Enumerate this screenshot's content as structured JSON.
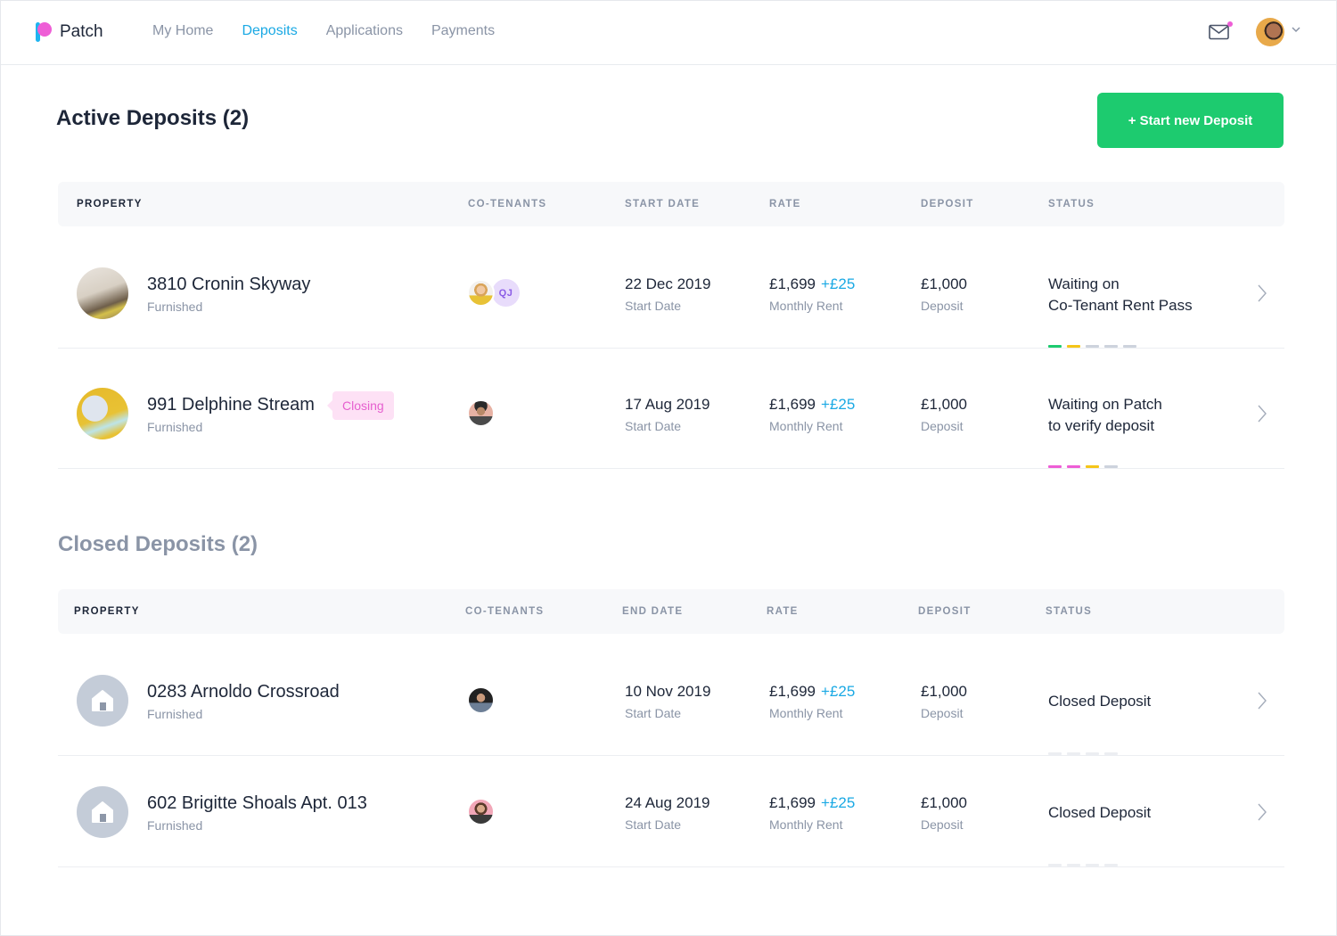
{
  "app": {
    "name": "Patch"
  },
  "nav": {
    "links": [
      {
        "label": "My Home",
        "active": false
      },
      {
        "label": "Deposits",
        "active": true
      },
      {
        "label": "Applications",
        "active": false
      },
      {
        "label": "Payments",
        "active": false
      }
    ],
    "mail_icon": "mail-icon",
    "has_notification": true
  },
  "colors": {
    "accent": "#1aa9e4",
    "brand_pink": "#ee5ed6",
    "primary_button": "#1dcb6f",
    "progress_green": "#1dcb6f",
    "progress_yellow": "#f5c518",
    "progress_pink": "#ee5ed6",
    "progress_grey": "#cdd3dd",
    "progress_faint": "#eceef2"
  },
  "active": {
    "heading": "Active Deposits (2)",
    "start_button": "+ Start new Deposit",
    "columns": [
      "PROPERTY",
      "CO-TENANTS",
      "START DATE",
      "RATE",
      "DEPOSIT",
      "STATUS"
    ],
    "rows": [
      {
        "name": "3810 Cronin Skyway",
        "type": "Furnished",
        "tag": "",
        "cotenant_initials": "QJ",
        "date": "22 Dec 2019",
        "date_label": "Start Date",
        "rate": "£1,699",
        "rate_extra": "+£25",
        "rate_label": "Monthly Rent",
        "deposit": "£1,000",
        "deposit_label": "Deposit",
        "status": "Waiting on\nCo-Tenant Rent Pass",
        "progress": [
          "green",
          "yellow",
          "grey",
          "grey",
          "grey"
        ]
      },
      {
        "name": "991 Delphine Stream",
        "type": "Furnished",
        "tag": "Closing",
        "cotenant_initials": "",
        "date": "17 Aug 2019",
        "date_label": "Start Date",
        "rate": "£1,699",
        "rate_extra": "+£25",
        "rate_label": "Monthly Rent",
        "deposit": "£1,000",
        "deposit_label": "Deposit",
        "status": "Waiting on Patch\nto verify deposit",
        "progress": [
          "pink",
          "pink",
          "yellow",
          "grey"
        ]
      }
    ]
  },
  "closed": {
    "heading": "Closed Deposits (2)",
    "columns": [
      "PROPERTY",
      "CO-TENANTS",
      "END DATE",
      "RATE",
      "DEPOSIT",
      "STATUS"
    ],
    "rows": [
      {
        "name": "0283 Arnoldo Crossroad",
        "type": "Furnished",
        "date": "10 Nov 2019",
        "date_label": "Start Date",
        "rate": "£1,699",
        "rate_extra": "+£25",
        "rate_label": "Monthly Rent",
        "deposit": "£1,000",
        "deposit_label": "Deposit",
        "status": "Closed Deposit",
        "progress": [
          "faint",
          "faint",
          "faint",
          "faint"
        ]
      },
      {
        "name": "602 Brigitte Shoals Apt. 013",
        "type": "Furnished",
        "date": "24 Aug 2019",
        "date_label": "Start Date",
        "rate": "£1,699",
        "rate_extra": "+£25",
        "rate_label": "Monthly Rent",
        "deposit": "£1,000",
        "deposit_label": "Deposit",
        "status": "Closed Deposit",
        "progress": [
          "faint",
          "faint",
          "faint",
          "faint"
        ]
      }
    ]
  }
}
